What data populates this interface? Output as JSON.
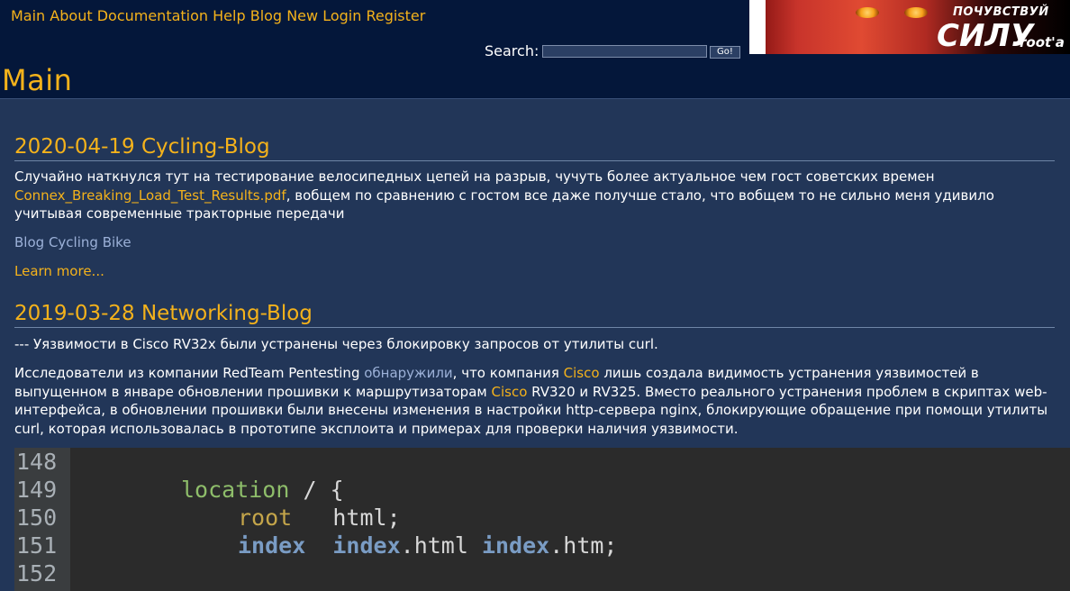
{
  "nav": [
    "Main",
    "About",
    "Documentation",
    "Help",
    "Blog",
    "New",
    "Login",
    "Register"
  ],
  "search": {
    "label": "Search:",
    "button": "Go!",
    "value": ""
  },
  "banner": {
    "line1": "ПОЧУВСТВУЙ",
    "line2": "СИЛУ",
    "line3": "root'a"
  },
  "page_title": "Main",
  "posts": [
    {
      "title": "2020-04-19 Cycling-Blog",
      "p1_before": "Случайно наткнулся тут на тестирование велосипедных цепей на разрыв, чучуть более актуальное чем гост советских времен",
      "p1_link": "Connex_Breaking_Load_Test_Results.pdf",
      "p1_after": ", вобщем по сравнению с гостом все даже получше стало, что вобщем то не сильно меня удивило учитывая современные тракторные передачи",
      "tags": [
        "Blog",
        "Cycling",
        "Bike"
      ],
      "learn_more": "Learn more..."
    },
    {
      "title": "2019-03-28 Networking-Blog",
      "p1": "--- Уязвимости в Cisco RV32x были устранены через блокировку запросов от утилиты curl.",
      "p2_a": "Исследователи из компании RedTeam Pentesting ",
      "p2_link1": "обнаружили",
      "p2_b": ", что компания ",
      "p2_link2": "Cisco",
      "p2_c": " лишь создала видимость устранения уязвимостей в выпущенном в январе обновлении прошивки к маршрутизаторам ",
      "p2_link3": "Cisco",
      "p2_d": " RV320 и RV325. Вместо реального устранения проблем в скриптах web-интерфейса, в обновлении прошивки были внесены изменения в настройки http-сервера nginx, блокирующие обращение при помощи утилиты curl, которая использовалась в прототипе эксплоита и примерах для проверки наличия уязвимости."
    }
  ],
  "code": {
    "line_numbers": [
      "148",
      "149",
      "150",
      "151",
      "152"
    ],
    "location_kw": "location",
    "location_rest": " / {",
    "root_kw": "root",
    "root_rest": "   html;",
    "index_kw": "index",
    "index_a": "index",
    "index_a_rest": ".html ",
    "index_b": "index",
    "index_b_rest": ".htm;"
  }
}
